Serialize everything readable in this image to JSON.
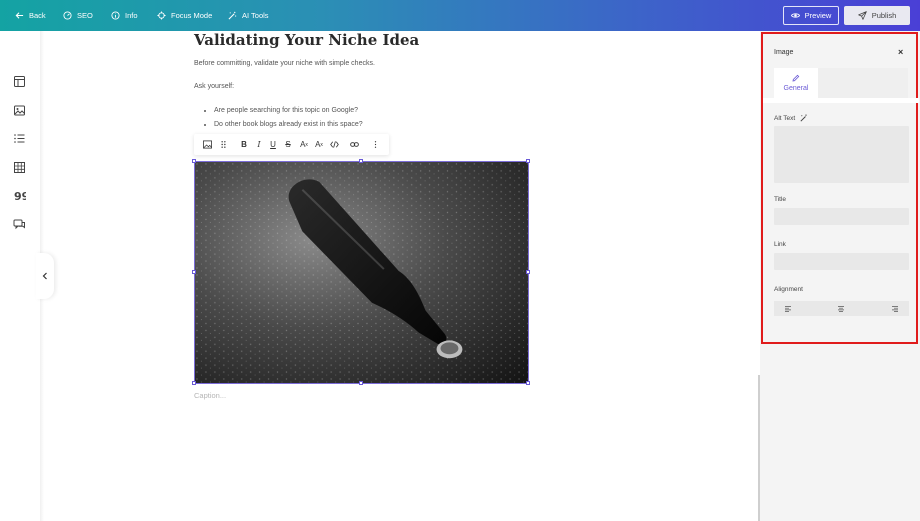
{
  "topbar": {
    "back": "Back",
    "seo": "SEO",
    "info": "Info",
    "focus_mode": "Focus Mode",
    "ai_tools": "AI Tools",
    "preview": "Preview",
    "publish": "Publish"
  },
  "left_rail": {
    "icons": [
      "layout-icon",
      "image-icon",
      "list-icon",
      "table-icon",
      "quote-icon",
      "comments-icon"
    ]
  },
  "editor": {
    "title": "Validating Your Niche Idea",
    "paragraph1": "Before committing, validate your niche with simple checks.",
    "paragraph2": "Ask yourself:",
    "bullets": [
      "Are people searching for this topic on Google?",
      "Do other book blogs already exist in this space?"
    ],
    "toolbar_tools": [
      "image",
      "drag",
      "bold",
      "italic",
      "underline",
      "strikethrough",
      "superscript",
      "subscript",
      "code",
      "link",
      "more"
    ],
    "image_caption_placeholder": "Caption..."
  },
  "panel": {
    "title": "Image",
    "tab_general": "General",
    "alt_text_label": "Alt Text",
    "title_label": "Title",
    "link_label": "Link",
    "alignment_label": "Alignment",
    "alignment_options": [
      "left",
      "center",
      "right"
    ]
  },
  "colors": {
    "accent": "#6b5bd6",
    "highlight_box": "#e01b1b",
    "topbar_start": "#14a3a3",
    "topbar_end": "#4a3fd6"
  }
}
